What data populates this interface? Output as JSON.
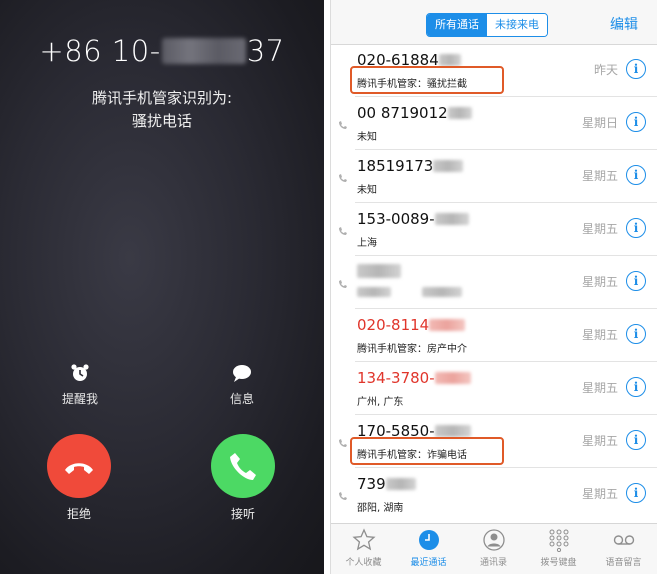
{
  "call": {
    "number_prefix": "+86 10-",
    "number_suffix": "37",
    "identified_label": "腾讯手机管家识别为:",
    "identified_value": "骚扰电话",
    "remind_label": "提醒我",
    "message_label": "信息",
    "decline_label": "拒绝",
    "accept_label": "接听",
    "decline_color": "#f04a3a",
    "accept_color": "#4cd964"
  },
  "recents": {
    "segment_all": "所有通话",
    "segment_missed": "未接来电",
    "edit_label": "编辑",
    "info_glyph": "i",
    "rows": [
      {
        "number": "020-61884",
        "sub": "腾讯手机管家：骚扰拦截",
        "date": "昨天",
        "missed": false
      },
      {
        "number": "00 8719012",
        "sub": "未知",
        "date": "星期日",
        "missed": false
      },
      {
        "number": "18519173",
        "sub": "未知",
        "date": "星期五",
        "missed": false
      },
      {
        "number": "153-0089-",
        "sub": "上海",
        "date": "星期五",
        "missed": false
      },
      {
        "number": "",
        "sub": "",
        "date": "星期五",
        "missed": false
      },
      {
        "number": "020-8114",
        "sub": "腾讯手机管家：房产中介",
        "date": "星期五",
        "missed": true
      },
      {
        "number": "134-3780-",
        "sub": "广州, 广东",
        "date": "星期五",
        "missed": true
      },
      {
        "number": "170-5850-",
        "sub": "腾讯手机管家：诈骗电话",
        "date": "星期五",
        "missed": false
      },
      {
        "number": "739",
        "sub": "邵阳, 湖南",
        "date": "星期五",
        "missed": false
      }
    ],
    "tabs": [
      {
        "label": "个人收藏",
        "icon": "star-icon"
      },
      {
        "label": "最近通话",
        "icon": "clock-icon"
      },
      {
        "label": "通讯录",
        "icon": "contacts-icon"
      },
      {
        "label": "拨号键盘",
        "icon": "keypad-icon"
      },
      {
        "label": "语音留言",
        "icon": "voicemail-icon"
      }
    ],
    "accent_color": "#1d8ee8",
    "highlight_color": "#e05a28"
  }
}
